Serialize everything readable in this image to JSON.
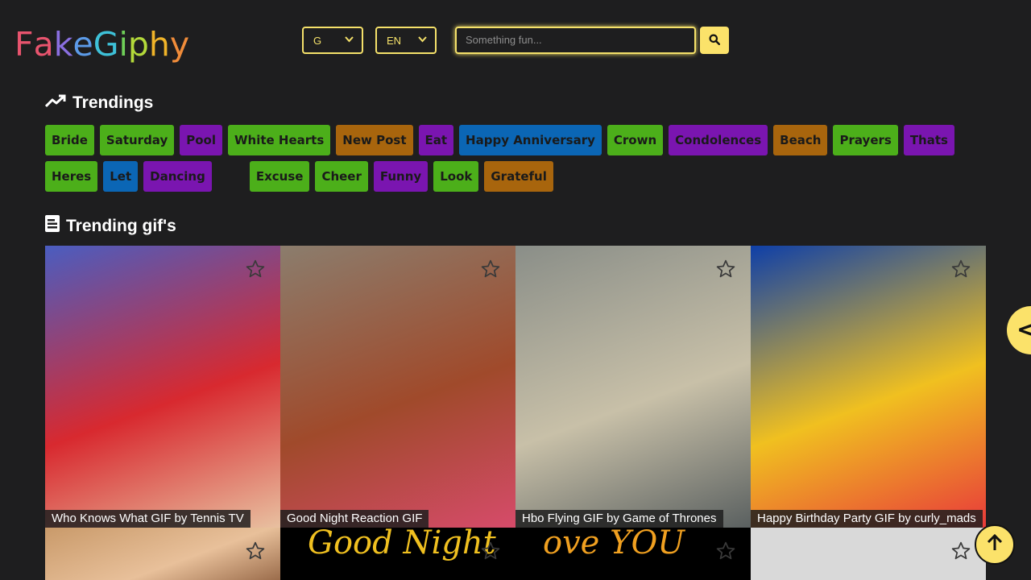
{
  "logo": {
    "letters": [
      "F",
      "a",
      "k",
      "e",
      "G",
      "i",
      "p",
      "h",
      "y"
    ],
    "colors": [
      "#e8546e",
      "#e8546e",
      "#8a6fe0",
      "#5c9be8",
      "#3ec1d8",
      "#6fcf58",
      "#b3d93a",
      "#f0b429",
      "#f08c3a"
    ]
  },
  "header": {
    "rating_select": "G",
    "language_select": "EN",
    "search": {
      "placeholder": "Something fun...",
      "icon": "search-icon"
    }
  },
  "trendings": {
    "title": "Trendings",
    "icon": "trending-up-icon",
    "tags": [
      {
        "label": "Bride",
        "color": "#4caf1a"
      },
      {
        "label": "Saturday",
        "color": "#4caf1a"
      },
      {
        "label": "Pool",
        "color": "#7a15b0"
      },
      {
        "label": "White Hearts",
        "color": "#4caf1a"
      },
      {
        "label": "New Post",
        "color": "#a8650d"
      },
      {
        "label": "Eat",
        "color": "#7a15b0"
      },
      {
        "label": "Happy Anniversary",
        "color": "#0b66b5"
      },
      {
        "label": "Crown",
        "color": "#4caf1a"
      },
      {
        "label": "Condolences",
        "color": "#7a15b0"
      },
      {
        "label": "Beach",
        "color": "#a8650d"
      },
      {
        "label": "Prayers",
        "color": "#4caf1a"
      },
      {
        "label": "Thats",
        "color": "#7a15b0"
      },
      {
        "label": "Heres",
        "color": "#4caf1a"
      },
      {
        "label": "Let",
        "color": "#0b66b5"
      },
      {
        "label": "Dancing",
        "color": "#7a15b0"
      },
      {
        "label": "Excuse",
        "color": "#4caf1a"
      },
      {
        "label": "Cheer",
        "color": "#4caf1a"
      },
      {
        "label": "Funny",
        "color": "#7a15b0"
      },
      {
        "label": "Look",
        "color": "#4caf1a"
      },
      {
        "label": "Grateful",
        "color": "#a8650d"
      }
    ]
  },
  "gifs_section": {
    "title": "Trending gif's",
    "icon": "document-icon",
    "gifs": [
      {
        "caption": "Who Knows What GIF by Tennis TV",
        "palette": [
          "#4a5dc0",
          "#d8292f",
          "#e8c0a0"
        ]
      },
      {
        "caption": "Good Night Reaction GIF",
        "palette": [
          "#8b7d6d",
          "#a04a2b",
          "#d64b6a"
        ]
      },
      {
        "caption": "Hbo Flying GIF by Game of Thrones",
        "palette": [
          "#8a8e88",
          "#c8c0a8",
          "#5a6060"
        ]
      },
      {
        "caption": "Happy Birthday Party GIF by curly_mads",
        "palette": [
          "#0e3fa8",
          "#f0c020",
          "#e83a3a"
        ]
      },
      {
        "caption": "",
        "palette": [
          "#c99a6a",
          "#e8c09a",
          "#8a5a3a"
        ]
      },
      {
        "caption": "",
        "overlay_text": "Good Night",
        "palette": [
          "#000000",
          "#f0c020"
        ]
      },
      {
        "caption": "",
        "overlay_text": "ove YOU",
        "palette": [
          "#000000",
          "#f0a020"
        ]
      },
      {
        "caption": "",
        "palette": [
          "#d9d9d9"
        ]
      }
    ]
  },
  "controls": {
    "side_tab_symbol": "<",
    "scroll_top_icon": "arrow-up-icon"
  }
}
